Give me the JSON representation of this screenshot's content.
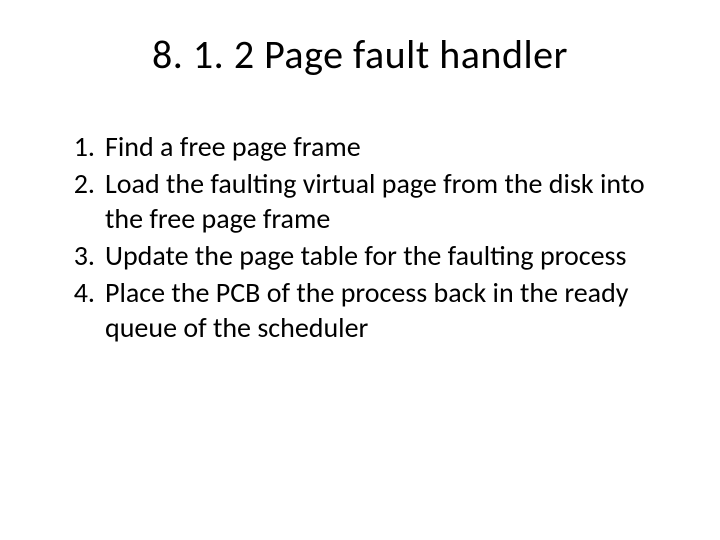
{
  "title": "8. 1. 2 Page fault handler",
  "items": [
    "Find a free page frame",
    "Load the faulting virtual page from the disk into the free page frame",
    "Update the page table for the faulting process",
    "Place the PCB of the process back in the ready queue of the scheduler"
  ]
}
